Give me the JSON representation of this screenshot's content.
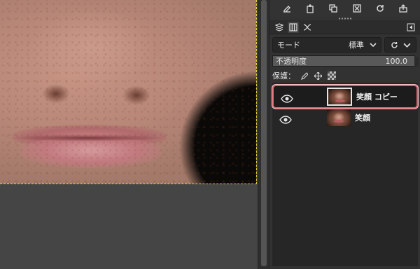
{
  "canvas": {
    "image_description": "close-up face photo: nose, freckled cheeks, lips"
  },
  "toolbar": {
    "icons": [
      "edit-layer-attributes-icon",
      "new-layer-icon",
      "duplicate-layer-icon",
      "delete-layer-icon",
      "reset-icon",
      "export-icon"
    ]
  },
  "tabs": {
    "icons": [
      "layers-icon",
      "channels-icon",
      "paths-icon",
      "dock-menu-icon"
    ]
  },
  "layers_panel": {
    "mode_label": "モード",
    "mode_value": "標準",
    "opacity_label": "不透明度",
    "opacity_value": "100.0",
    "lock_label": "保護：",
    "layers": [
      {
        "name": "笑顔 コピー",
        "visible": true,
        "selected": true
      },
      {
        "name": "笑顔",
        "visible": true,
        "selected": false
      }
    ]
  },
  "colors": {
    "highlight_border": "#e0606f",
    "selection_dash": "#e8d030",
    "panel_bg": "#323232"
  }
}
